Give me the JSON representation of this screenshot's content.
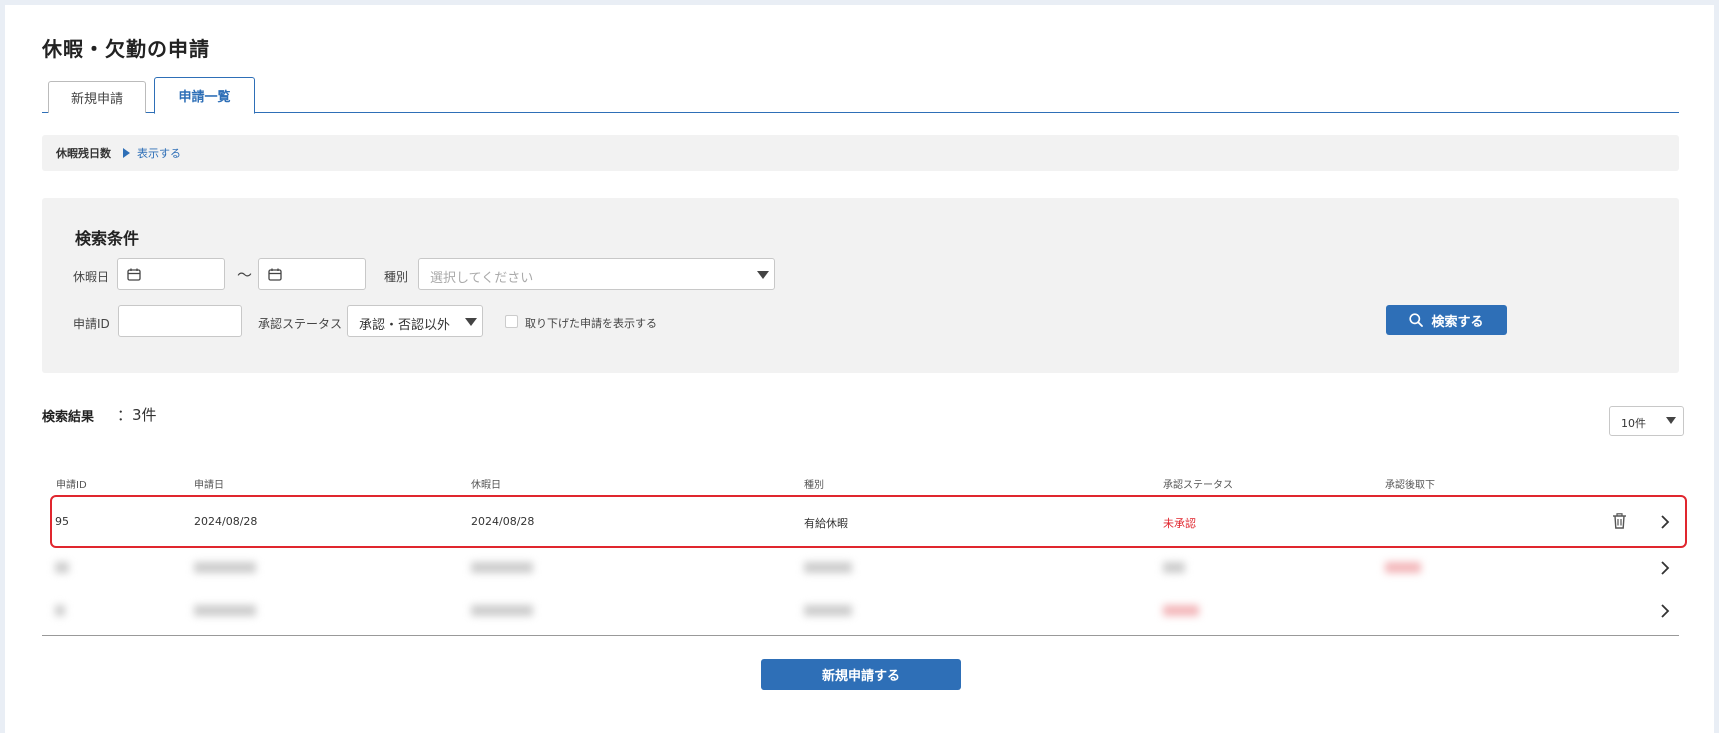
{
  "page": {
    "title": "休暇・欠勤の申請",
    "tabs": [
      {
        "label": "新規申請",
        "active": false
      },
      {
        "label": "申請一覧",
        "active": true
      }
    ]
  },
  "remaining_days": {
    "label": "休暇残日数",
    "toggle_label": "表示する"
  },
  "search": {
    "title": "検索条件",
    "holiday_label": "休暇日",
    "date_from": "",
    "date_to": "",
    "range_separator": "～",
    "type_label": "種別",
    "type_placeholder": "選択してください",
    "request_id_label": "申請ID",
    "request_id_value": "",
    "status_label": "承認ステータス",
    "status_value": "承認・否認以外",
    "show_withdrawn_label": "取り下げた申請を表示する",
    "show_withdrawn_checked": false,
    "search_button": "検索する"
  },
  "results": {
    "label": "検索結果",
    "count": "：3件",
    "per_page": "10件",
    "columns": [
      "申請ID",
      "申請日",
      "休暇日",
      "種別",
      "承認ステータス",
      "承認後取下"
    ],
    "rows": [
      {
        "id": "95",
        "applied": "2024/08/28",
        "holiday": "2024/08/28",
        "type": "有給休暇",
        "status": "未承認",
        "withdraw": "",
        "deletable": true
      }
    ]
  },
  "footer": {
    "new_request_button": "新規申請する"
  },
  "colors": {
    "accent": "#2e6fb7",
    "status_red": "#e0262e"
  }
}
